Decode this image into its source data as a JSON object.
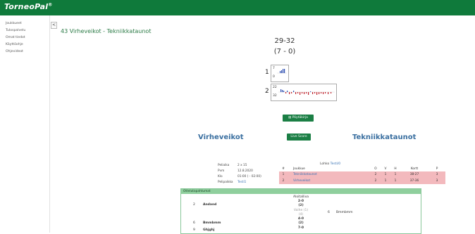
{
  "app": {
    "logo": "TorneoPal",
    "logo_mark": "®"
  },
  "sidebar": {
    "items": [
      {
        "label": "Joukkueet"
      },
      {
        "label": "Tulospalvelu"
      },
      {
        "label": "Omat tiedot"
      },
      {
        "label": "Käyttöohje"
      },
      {
        "label": "Ohjevideot"
      }
    ],
    "collapse_glyph": "<"
  },
  "page": {
    "title": "43  Virheveikot - Tekniikkataunot"
  },
  "match": {
    "score": "29-32",
    "halftime": "(7 - 0)",
    "periods": [
      {
        "label": "1",
        "top": "7",
        "bottom": "0"
      },
      {
        "label": "2",
        "top": "22",
        "bottom": "32"
      }
    ],
    "report_button": "Pöytäkirja",
    "live_button": "Live Score",
    "home_team": "Virheveikot",
    "away_team": "Tekniikkataunot",
    "info": {
      "peliaika_label": "Peliaika",
      "peliaika_value": "2 x 15",
      "pvm_label": "Pvm",
      "pvm_value": "12.8.2020",
      "klo_label": "Klo",
      "klo_value": "01:00 ( - 02:00)",
      "pelipaikka_label": "Pelipaikka",
      "pelipaikka_value": "Testi1"
    }
  },
  "standings": {
    "lohko_label": "Lohko",
    "lohko_value": "Testi/0",
    "headers": [
      "#",
      "Joukkue",
      "O",
      "V",
      "H",
      "Kortt",
      "P"
    ],
    "rows": [
      [
        "1",
        "Tekniikkataunot",
        "2",
        "1",
        "1",
        "38-27",
        "3"
      ],
      [
        "2",
        "Virheveikot",
        "2",
        "1",
        "1",
        "37-36",
        "3"
      ]
    ]
  },
  "events": {
    "header": "Ottelutapahtumat",
    "start_label": "Aloitalliva",
    "rows": [
      {
        "num": "2",
        "name": "Andand",
        "score": "2-0",
        "score2": "(2)"
      },
      {
        "side_note": "Vaihe (1)",
        "side_score": "(4)",
        "right_num": "6",
        "right_name": "Bmmbmm"
      },
      {
        "num": "6",
        "name": "Bmmbmm",
        "score": "4-0",
        "score2": "(2)"
      },
      {
        "num": "9",
        "name": "Ghjghj",
        "score": "7-0"
      }
    ]
  }
}
